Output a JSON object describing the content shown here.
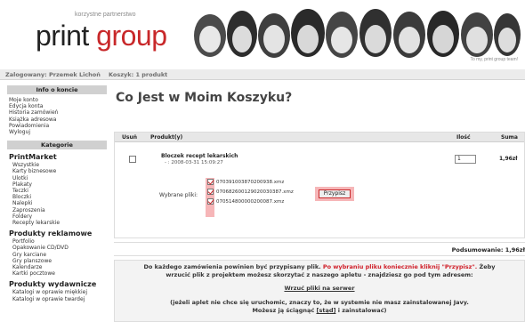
{
  "header": {
    "logo_tag": "korzystne partnerstwo",
    "logo_part1": "print ",
    "logo_part2": "group",
    "tagline": "To my, print group team!"
  },
  "topbar": {
    "logged_in": "Zalogowany: Przemek Lichoń",
    "cart": "Koszyk: 1 produkt"
  },
  "sidebar": {
    "account_header": "Info o koncie",
    "account_links": [
      "Moje konto",
      "Edycja konta",
      "Historia zamówień",
      "Książka adresowa",
      "Powiadomienia",
      "Wyloguj"
    ],
    "categories_header": "Kategorie",
    "groups": [
      {
        "title": "PrintMarket",
        "items": [
          "Wszystkie",
          "Karty biznesowe",
          "Ulotki",
          "Plakaty",
          "Teczki",
          "Bloczki",
          "Nalepki",
          "Zaproszenia",
          "Foldery",
          "Recepty lekarskie"
        ]
      },
      {
        "title": "Produkty reklamowe",
        "items": [
          "Portfolio",
          "Opakowanie CD/DVD",
          "Gry karciane",
          "Gry planszowe",
          "Kalendarze",
          "Kartki pocztowe"
        ]
      },
      {
        "title": "Produkty wydawnicze",
        "items": [
          "Katalogi w oprawie miękkiej",
          "Katalogi w oprawie twardej"
        ]
      }
    ]
  },
  "main": {
    "title": "Co Jest w Moim Koszyku?",
    "columns": {
      "remove": "Usuń",
      "product": "Produkt(y)",
      "qty": "Ilość",
      "total": "Suma"
    },
    "item": {
      "name": "Bloczek recept lekarskich",
      "date": "- : 2008-03-31 15:09:27",
      "qty": "1",
      "price": "1,96zł"
    },
    "files_label": "Wybrane pliki:",
    "files": [
      "070391003870200938.xmz",
      "070682600129020030387.xmz",
      "070514800000200087.xmz"
    ],
    "assign_button": "Przypisz",
    "summary": "Podsumowanie: 1,96zł"
  },
  "notice": {
    "line1_a": "Do każdego zamówienia powinien być przypisany plik.",
    "line1_b": "Po wybraniu pliku koniecznie kliknij \"Przypisz\".",
    "line1_c": "Żeby",
    "line2": "wrzucić plik z projektem możesz skorzytać z naszego apletu - znajdziesz go pod tym adresem:",
    "link": "Wrzuć pliki na serwer",
    "line4": "(jeżeli aplet nie chce się uruchomic, znaczy to, że w systemie nie masz zainstalowanej Javy.",
    "line5_a": "Możesz ją ściągnąć",
    "line5_link": "[stąd]",
    "line5_b": "i zainstalować)"
  },
  "colors": {
    "accent_red": "#c8282a",
    "highlight": "#f6b6b8"
  }
}
